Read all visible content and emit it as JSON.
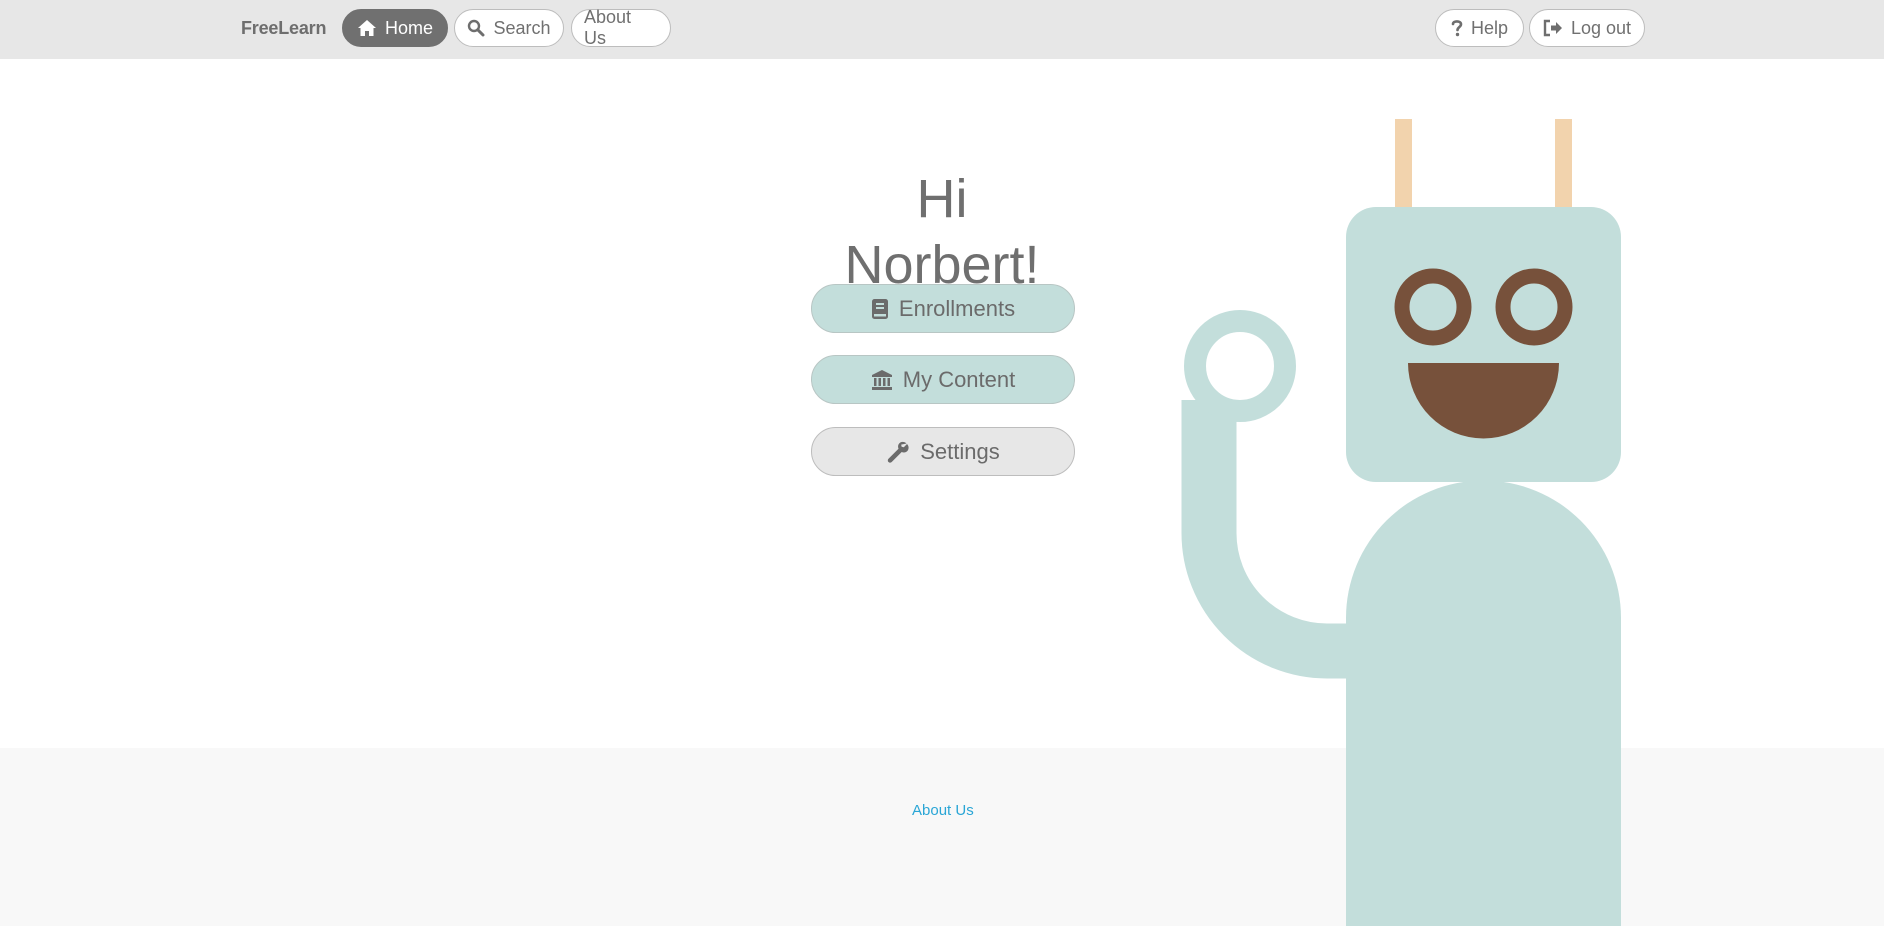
{
  "navbar": {
    "brand": "FreeLearn",
    "home_label": "Home",
    "search_label": "Search",
    "about_label": "About Us",
    "help_label": "Help",
    "logout_label": "Log out"
  },
  "hero": {
    "greeting": "Hi Norbert!",
    "buttons": {
      "enrollments": "Enrollments",
      "my_content": "My Content",
      "settings": "Settings"
    }
  },
  "footer": {
    "about_link": "About Us"
  },
  "icons": {
    "home": "home-icon",
    "search": "search-icon",
    "help": "question-icon",
    "logout": "sign-out-icon",
    "enrollments": "book-icon",
    "my_content": "institution-icon",
    "settings": "wrench-icon"
  },
  "colors": {
    "navbar_bg": "#e7e7e7",
    "active_pill": "#707070",
    "teal_button": "#c3dedb",
    "grey_button": "#e7e7e7",
    "footer_bg": "#f8f8f8",
    "link": "#2aa6d6",
    "robot_body": "#c3dedb",
    "robot_features": "#77513b",
    "robot_antenna": "#f2d3ad"
  }
}
